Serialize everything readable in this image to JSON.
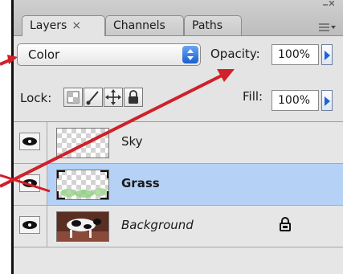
{
  "tabs": [
    {
      "label": "Layers",
      "close": "×"
    },
    {
      "label": "Channels"
    },
    {
      "label": "Paths"
    }
  ],
  "options": {
    "blend_mode": "Color",
    "opacity_label": "Opacity:",
    "opacity_value": "100%",
    "lock_label": "Lock:",
    "fill_label": "Fill:",
    "fill_value": "100%"
  },
  "layers": [
    {
      "name": "Sky",
      "selected": false,
      "style": "normal"
    },
    {
      "name": "Grass",
      "selected": true,
      "style": "bold"
    },
    {
      "name": "Background",
      "selected": false,
      "style": "italic",
      "locked": true
    }
  ],
  "colors": {
    "annotation_arrow": "#d0202a",
    "selection": "#b5d2f6",
    "accent_blue": "#1e63d6"
  }
}
